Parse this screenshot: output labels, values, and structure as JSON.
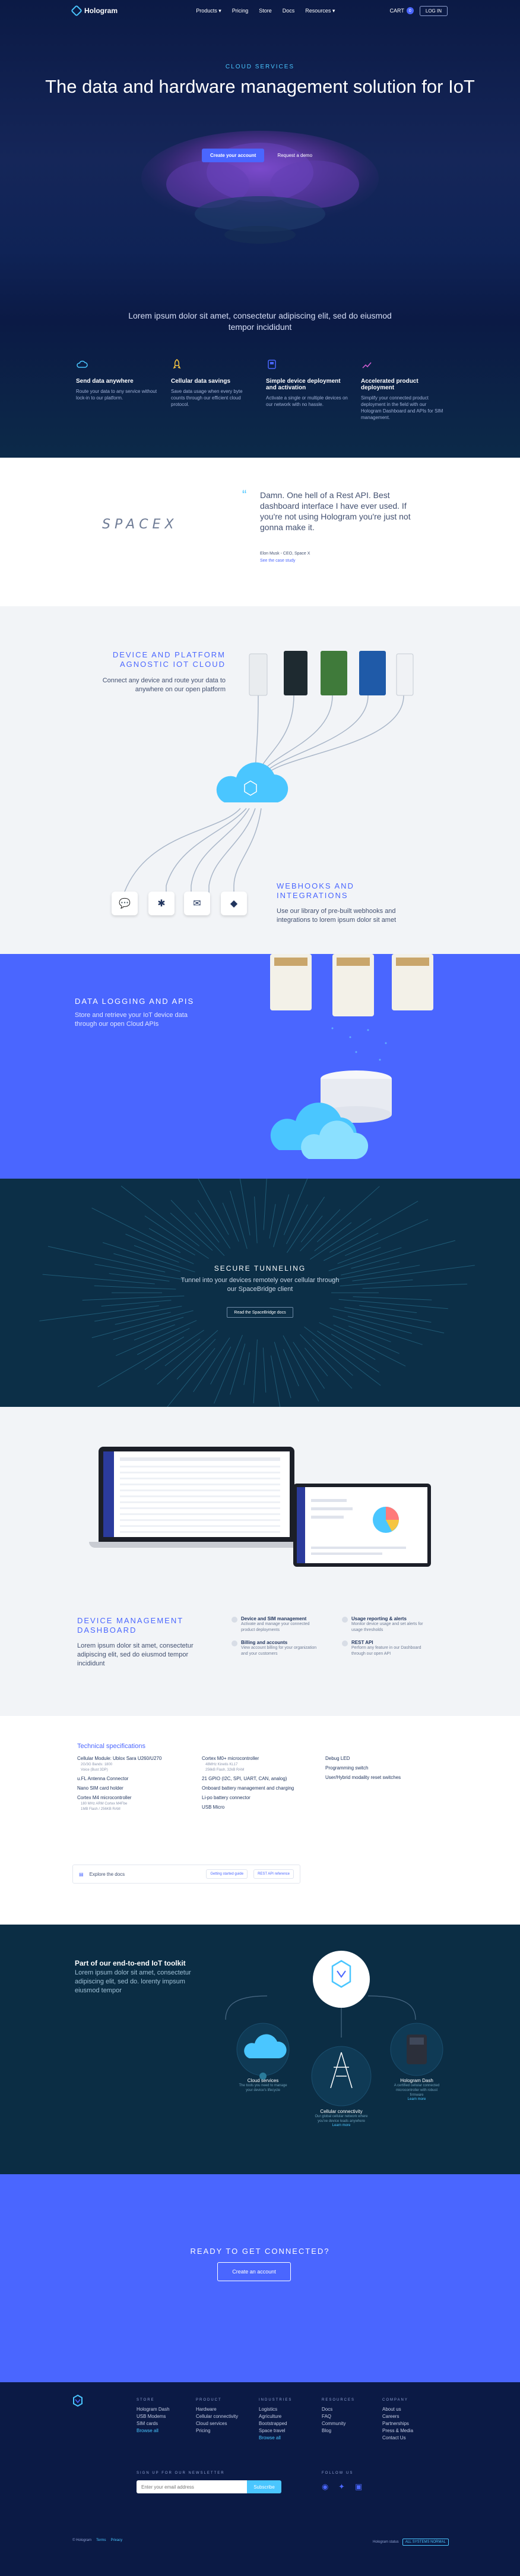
{
  "nav": {
    "logo": "Hologram",
    "links": [
      "Products ▾",
      "Pricing",
      "Store",
      "Docs",
      "Resources ▾"
    ],
    "cart_label": "CART",
    "cart_count": "0",
    "login": "LOG IN"
  },
  "hero": {
    "eyebrow": "CLOUD SERVICES",
    "title": "The data and hardware management solution for IoT",
    "cta_primary": "Create your account",
    "cta_secondary": "Request a demo",
    "lead": "Lorem ipsum dolor sit amet, consectetur adipiscing elit, sed do eiusmod tempor incididunt",
    "features": [
      {
        "title": "Send data anywhere",
        "text": "Route your data to any service without lock-in to our platform.",
        "icon": "cloud-icon"
      },
      {
        "title": "Cellular data savings",
        "text": "Save data usage when every byte counts through our efficient cloud protocol.",
        "icon": "rocket-icon"
      },
      {
        "title": "Simple device deployment and activation",
        "text": "Activate a single or multiple devices on our network with no hassle.",
        "icon": "device-icon"
      },
      {
        "title": "Accelerated product deployment",
        "text": "Simplify your connected product deployment in the field with our Hologram Dashboard and APIs for SIM management.",
        "icon": "chart-icon"
      }
    ]
  },
  "testimonial": {
    "logo": "SPACEX",
    "quote": "Damn. One hell of a Rest API. Best dashboard interface I have ever used. If you're not using Hologram you're just not gonna make it.",
    "author": "Elon Musk - CEO, Space X",
    "link": "See the case study"
  },
  "platform": {
    "title": "DEVICE AND PLATFORM AGNOSTIC IOT CLOUD",
    "text": "Connect any device and route your data to anywhere on our open platform",
    "webhooks_title": "WEBHOOKS AND INTEGRATIONS",
    "webhooks_text": "Use our library of pre-built webhooks and integrations to lorem ipsum dolor sit amet"
  },
  "logging": {
    "title": "DATA LOGGING AND APIS",
    "text": "Store and retrieve your IoT device data through our open Cloud APIs"
  },
  "tunnel": {
    "title": "SECURE TUNNELING",
    "text": "Tunnel into your devices remotely over cellular through our SpaceBridge client",
    "button": "Read the SpaceBridge docs"
  },
  "dashboard": {
    "title": "DEVICE MANAGEMENT DASHBOARD",
    "text": "Lorem ipsum dolor sit amet, consectetur adipiscing elit, sed do eiusmod tempor incididunt",
    "features": [
      {
        "title": "Device and SIM management",
        "text": "Activate and manage your connected product deployments"
      },
      {
        "title": "Usage reporting & alerts",
        "text": "Monitor device usage and set alerts for usage thresholds"
      },
      {
        "title": "Billing and accounts",
        "text": "View account billing for your organization and your customers"
      },
      {
        "title": "REST API",
        "text": "Perform any feature in our Dashboard through our open API"
      }
    ]
  },
  "specs": {
    "title": "Technical specifications",
    "col1": [
      {
        "t": "Cellular Module: Ublox Sara U260/U270",
        "subs": [
          "2G/3G Bands: 1800",
          "Voice (Bust 3DP)"
        ]
      },
      {
        "t": "u.FL Antenna Connector",
        "subs": []
      },
      {
        "t": "Nano SIM card holder",
        "subs": []
      },
      {
        "t": "Cortex M4 microcontroller",
        "subs": [
          "180 MHz ARM Cortex M4Fbe",
          "1MB Flash / 256KB RAM"
        ]
      }
    ],
    "col2": [
      {
        "t": "Cortex M0+ microcontroller",
        "subs": [
          "48MHz Kinetis KL17",
          "256kB Flash, 32kB RAM"
        ]
      },
      {
        "t": "21 GPIO (I2C, SPI, UART, CAN, analog)",
        "subs": []
      },
      {
        "t": "Onboard battery management and charging",
        "subs": []
      },
      {
        "t": "Li-po battery connector",
        "subs": []
      },
      {
        "t": "USB Micro",
        "subs": []
      }
    ],
    "col3": [
      {
        "t": "Debug LED",
        "subs": []
      },
      {
        "t": "Programming switch",
        "subs": []
      },
      {
        "t": "User/Hybrid modality reset switches",
        "subs": []
      }
    ],
    "docs_label": "Explore the docs",
    "docs_links": [
      "Getting started guide",
      "REST API reference"
    ]
  },
  "toolkit": {
    "title": "Part of our end-to-end IoT toolkit",
    "text": "Lorem ipsum dolor sit amet, consectetur adipiscing elit, sed do. lorenty impsum eiusmod tempor",
    "items": [
      {
        "title": "Cloud services",
        "text": "The tools you need to manage your device's lifecycle",
        "link": ""
      },
      {
        "title": "Cellular connectivity",
        "text": "Our global cellular network where you've device leads anywhere",
        "link": "Learn more"
      },
      {
        "title": "Hologram Dash",
        "text": "A certified cellular connected microcontroller with robust firmware",
        "link": "Learn more"
      }
    ]
  },
  "cta": {
    "title": "READY TO GET CONNECTED?",
    "button": "Create an account"
  },
  "footer": {
    "cols": [
      {
        "title": "STORE",
        "items": [
          "Hologram Dash",
          "USB Modems",
          "SIM cards",
          "Browse all"
        ]
      },
      {
        "title": "PRODUCT",
        "items": [
          "Hardware",
          "Cellular connectivity",
          "Cloud services",
          "Pricing"
        ]
      },
      {
        "title": "INDUSTRIES",
        "items": [
          "Logistics",
          "Agriculture",
          "Bootstrapped",
          "Space travel",
          "Browse all"
        ]
      },
      {
        "title": "RESOURCES",
        "items": [
          "Docs",
          "FAQ",
          "Community",
          "Blog"
        ]
      },
      {
        "title": "COMPANY",
        "items": [
          "About us",
          "Careers",
          "Partnerships",
          "Press & Media",
          "Contact Us"
        ]
      }
    ],
    "newsletter": "SIGN UP FOR OUR NEWSLETTER",
    "email_placeholder": "Enter your email address",
    "subscribe": "Subscribe",
    "follow": "FOLLOW US",
    "copyright": "© Hologram",
    "terms": "Terms",
    "privacy": "Privacy",
    "status_label": "Hologram status",
    "status_badge": "ALL SYSTEMS NORMAL"
  }
}
